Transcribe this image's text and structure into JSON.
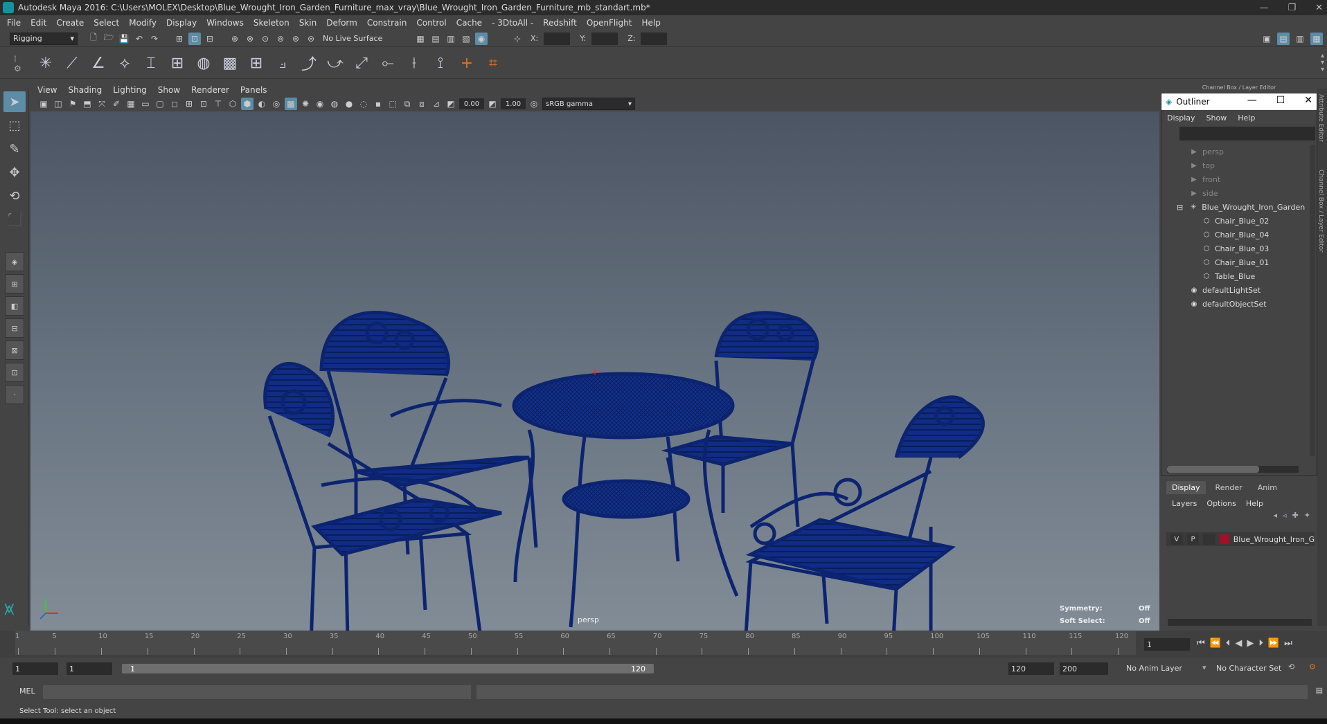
{
  "window": {
    "title": "Autodesk Maya 2016: C:\\Users\\MOLEX\\Desktop\\Blue_Wrought_Iron_Garden_Furniture_max_vray\\Blue_Wrought_Iron_Garden_Furniture_mb_standart.mb*"
  },
  "menubar": {
    "items": [
      "File",
      "Edit",
      "Create",
      "Select",
      "Modify",
      "Display",
      "Windows",
      "Skeleton",
      "Skin",
      "Deform",
      "Constrain",
      "Control",
      "Cache",
      "- 3DtoAll -",
      "Redshift",
      "OpenFlight",
      "Help"
    ]
  },
  "statusline": {
    "mode": "Rigging",
    "live_surface": "No Live Surface",
    "x_label": "X:",
    "y_label": "Y:",
    "z_label": "Z:"
  },
  "panel": {
    "menu": [
      "View",
      "Shading",
      "Lighting",
      "Show",
      "Renderer",
      "Panels"
    ],
    "near_value": "0.00",
    "far_value": "1.00",
    "color_space": "sRGB gamma",
    "camera": "persp",
    "symmetry_label": "Symmetry:",
    "symmetry_value": "Off",
    "soft_select_label": "Soft Select:",
    "soft_select_value": "Off"
  },
  "outliner": {
    "title": "Outliner",
    "menu": [
      "Display",
      "Show",
      "Help"
    ],
    "items": [
      {
        "label": "persp",
        "icon": "camera-icon",
        "dim": true,
        "indent": 1
      },
      {
        "label": "top",
        "icon": "camera-icon",
        "dim": true,
        "indent": 1
      },
      {
        "label": "front",
        "icon": "camera-icon",
        "dim": true,
        "indent": 1
      },
      {
        "label": "side",
        "icon": "camera-icon",
        "dim": true,
        "indent": 1
      },
      {
        "label": "Blue_Wrought_Iron_Garden",
        "icon": "group-icon",
        "dim": false,
        "indent": 0
      },
      {
        "label": "Chair_Blue_02",
        "icon": "mesh-icon",
        "dim": false,
        "indent": 2
      },
      {
        "label": "Chair_Blue_04",
        "icon": "mesh-icon",
        "dim": false,
        "indent": 2
      },
      {
        "label": "Chair_Blue_03",
        "icon": "mesh-icon",
        "dim": false,
        "indent": 2
      },
      {
        "label": "Chair_Blue_01",
        "icon": "mesh-icon",
        "dim": false,
        "indent": 2
      },
      {
        "label": "Table_Blue",
        "icon": "mesh-icon",
        "dim": false,
        "indent": 2
      },
      {
        "label": "defaultLightSet",
        "icon": "set-icon",
        "dim": false,
        "indent": 1
      },
      {
        "label": "defaultObjectSet",
        "icon": "set-icon",
        "dim": false,
        "indent": 1
      }
    ]
  },
  "side_tabs": {
    "top": "Channel Box / Layer Editor",
    "attr": "Attribute Editor",
    "cb": "Channel Box / Layer Editor"
  },
  "layers": {
    "tabs": [
      "Display",
      "Render",
      "Anim"
    ],
    "menu": [
      "Layers",
      "Options",
      "Help"
    ],
    "layer": {
      "v": "V",
      "p": "P",
      "name": "Blue_Wrought_Iron_G",
      "color": "#a0102a"
    }
  },
  "timeline": {
    "ticks": [
      "5",
      "10",
      "15",
      "20",
      "25",
      "30",
      "35",
      "40",
      "45",
      "50",
      "55",
      "60",
      "65",
      "70",
      "75",
      "80",
      "85",
      "90",
      "95",
      "100",
      "105",
      "110",
      "115",
      "120"
    ],
    "start_tick": "1",
    "current_frame": "1"
  },
  "range": {
    "start": "1",
    "playback_start": "1",
    "slider_start": "1",
    "slider_end": "120",
    "playback_end": "120",
    "end": "200",
    "anim_layer": "No Anim Layer",
    "char_set": "No Character Set"
  },
  "command": {
    "label": "MEL"
  },
  "helpline": {
    "text": "Select Tool: select an object"
  },
  "colors": {
    "furniture": "#0f2e8a",
    "accent": "#5d8ca7"
  }
}
